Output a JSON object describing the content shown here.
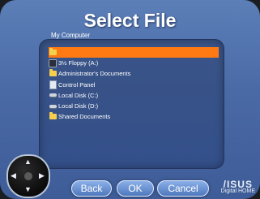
{
  "dialog": {
    "title": "Select File",
    "location": "My Computer"
  },
  "files": [
    {
      "label": "",
      "icon": "folder-icon",
      "selected": true
    },
    {
      "label": "3½ Floppy (A:)",
      "icon": "floppy-icon",
      "selected": false
    },
    {
      "label": "Administrator's Documents",
      "icon": "folder-icon",
      "selected": false
    },
    {
      "label": "Control Panel",
      "icon": "control-panel-icon",
      "selected": false
    },
    {
      "label": "Local Disk (C:)",
      "icon": "disk-icon",
      "selected": false
    },
    {
      "label": "Local Disk (D:)",
      "icon": "disk-icon",
      "selected": false
    },
    {
      "label": "Shared Documents",
      "icon": "folder-icon",
      "selected": false
    }
  ],
  "buttons": {
    "back": "Back",
    "ok": "OK",
    "cancel": "Cancel"
  },
  "remote": {
    "arrows": {
      "up": "▲",
      "down": "▼",
      "left": "◀",
      "right": "▶"
    }
  },
  "brand": {
    "logo": "/ISUS",
    "sub": "Digital HOME"
  },
  "colors": {
    "accent": "#ff7a12",
    "background": "#4a6aa6"
  }
}
